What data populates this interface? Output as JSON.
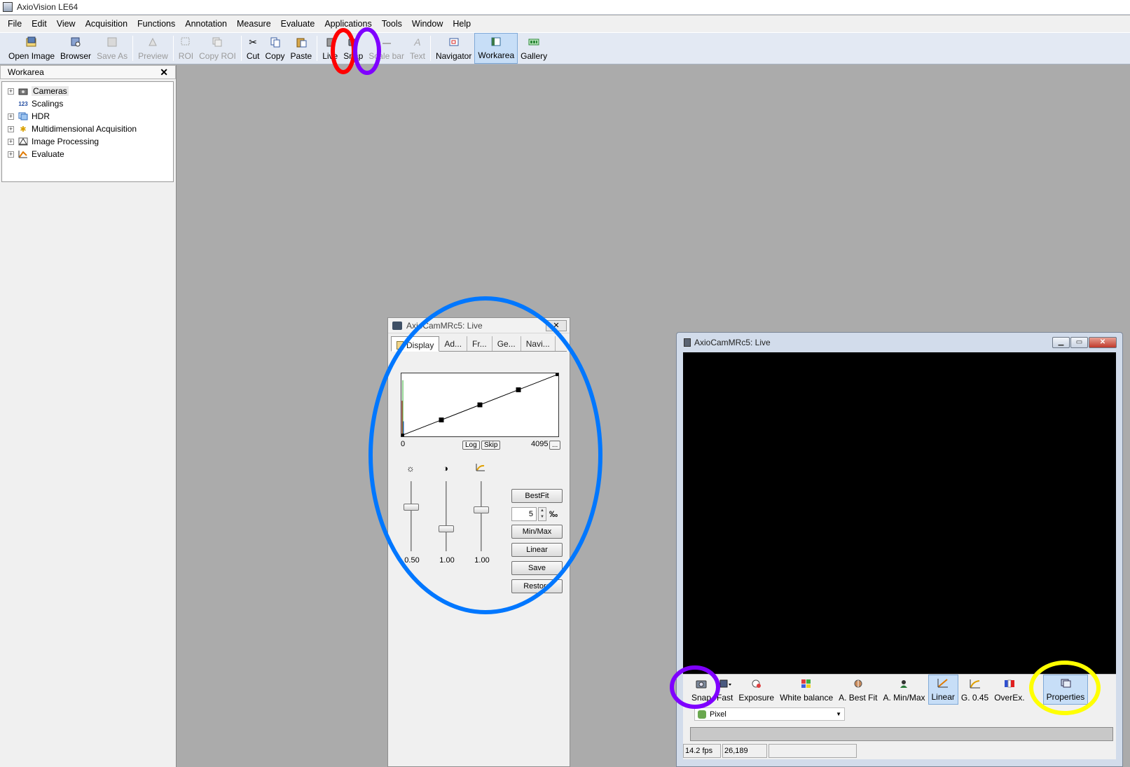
{
  "window": {
    "title": "AxioVision LE64"
  },
  "menu": [
    "File",
    "Edit",
    "View",
    "Acquisition",
    "Functions",
    "Annotation",
    "Measure",
    "Evaluate",
    "Applications",
    "Tools",
    "Window",
    "Help"
  ],
  "toolbar": {
    "buttons": [
      {
        "label": "Open Image",
        "icon": "open-image-icon",
        "enabled": true
      },
      {
        "label": "Browser",
        "icon": "browser-icon",
        "enabled": true
      },
      {
        "label": "Save As",
        "icon": "save-icon",
        "enabled": false
      },
      {
        "label": "Preview",
        "icon": "preview-icon",
        "enabled": false
      },
      {
        "label": "ROI",
        "icon": "roi-icon",
        "enabled": false
      },
      {
        "label": "Copy ROI",
        "icon": "copy-roi-icon",
        "enabled": false
      },
      {
        "label": "Cut",
        "icon": "scissors-icon",
        "enabled": true
      },
      {
        "label": "Copy",
        "icon": "copy-icon",
        "enabled": true
      },
      {
        "label": "Paste",
        "icon": "paste-icon",
        "enabled": true
      },
      {
        "label": "Live",
        "icon": "live-camera-icon",
        "enabled": true
      },
      {
        "label": "Snap",
        "icon": "snap-camera-icon",
        "enabled": true
      },
      {
        "label": "Scale bar",
        "icon": "scale-bar-icon",
        "enabled": false
      },
      {
        "label": "Text",
        "icon": "text-icon",
        "enabled": false
      },
      {
        "label": "Navigator",
        "icon": "navigator-icon",
        "enabled": true
      },
      {
        "label": "Workarea",
        "icon": "workarea-icon",
        "enabled": true,
        "active": true
      },
      {
        "label": "Gallery",
        "icon": "gallery-icon",
        "enabled": true
      }
    ]
  },
  "workarea": {
    "title": "Workarea",
    "tree": [
      {
        "label": "Cameras",
        "icon": "camera-icon",
        "expandable": true,
        "selected": true
      },
      {
        "label": "Scalings",
        "icon": "scaling-icon",
        "expandable": false
      },
      {
        "label": "HDR",
        "icon": "hdr-icon",
        "expandable": true
      },
      {
        "label": "Multidimensional Acquisition",
        "icon": "multidimensional-icon",
        "expandable": true
      },
      {
        "label": "Image Processing",
        "icon": "image-processing-icon",
        "expandable": true
      },
      {
        "label": "Evaluate",
        "icon": "evaluate-icon",
        "expandable": true
      }
    ]
  },
  "properties_dialog": {
    "title": "AxioCamMRc5: Live",
    "tabs": [
      "Display",
      "Ad...",
      "Fr...",
      "Ge...",
      "Navi..."
    ],
    "active_tab": "Display",
    "curve": {
      "min_label": "0",
      "max_label": "4095",
      "log_label": "Log",
      "skip_label": "Skip",
      "more_label": "...",
      "points_fraction": [
        [
          0,
          0
        ],
        [
          0.25,
          0.25
        ],
        [
          0.5,
          0.5
        ],
        [
          0.75,
          0.75
        ],
        [
          1,
          1
        ]
      ]
    },
    "sliders": [
      {
        "icon": "brightness-icon",
        "value": "0.50",
        "level": 0.65
      },
      {
        "icon": "contrast-icon",
        "value": "1.00",
        "level": 0.3
      },
      {
        "icon": "gamma-icon",
        "value": "1.00",
        "level": 0.6
      }
    ],
    "buttons": {
      "bestfit": "BestFit",
      "minmax": "Min/Max",
      "linear": "Linear",
      "save": "Save",
      "restore": "Restore"
    },
    "permille": {
      "value": "5",
      "unit": "‰"
    }
  },
  "live_window": {
    "title": "AxioCamMRc5: Live",
    "toolbar": [
      {
        "label": "Snap",
        "icon": "snap-camera-icon"
      },
      {
        "label": "Fast",
        "icon": "fast-icon"
      },
      {
        "label": "Exposure",
        "icon": "exposure-icon"
      },
      {
        "label": "White balance",
        "icon": "white-balance-icon"
      },
      {
        "label": "A. Best Fit",
        "icon": "auto-best-fit-icon"
      },
      {
        "label": "A. Min/Max",
        "icon": "auto-min-max-icon"
      },
      {
        "label": "Linear",
        "icon": "linear-icon",
        "active": true
      },
      {
        "label": "G. 0.45",
        "icon": "gamma-icon"
      },
      {
        "label": "OverEx.",
        "icon": "overexposure-icon"
      },
      {
        "label": "Properties",
        "icon": "properties-icon",
        "active": true
      }
    ],
    "scaling": "Pixel",
    "status": {
      "fps": "14.2 fps",
      "coords": "26,189",
      "extra": ""
    }
  },
  "annotations": {
    "red": "#ff0000",
    "purple": "#7f00ff",
    "blue": "#0077ff",
    "yellow": "#ffff00"
  }
}
